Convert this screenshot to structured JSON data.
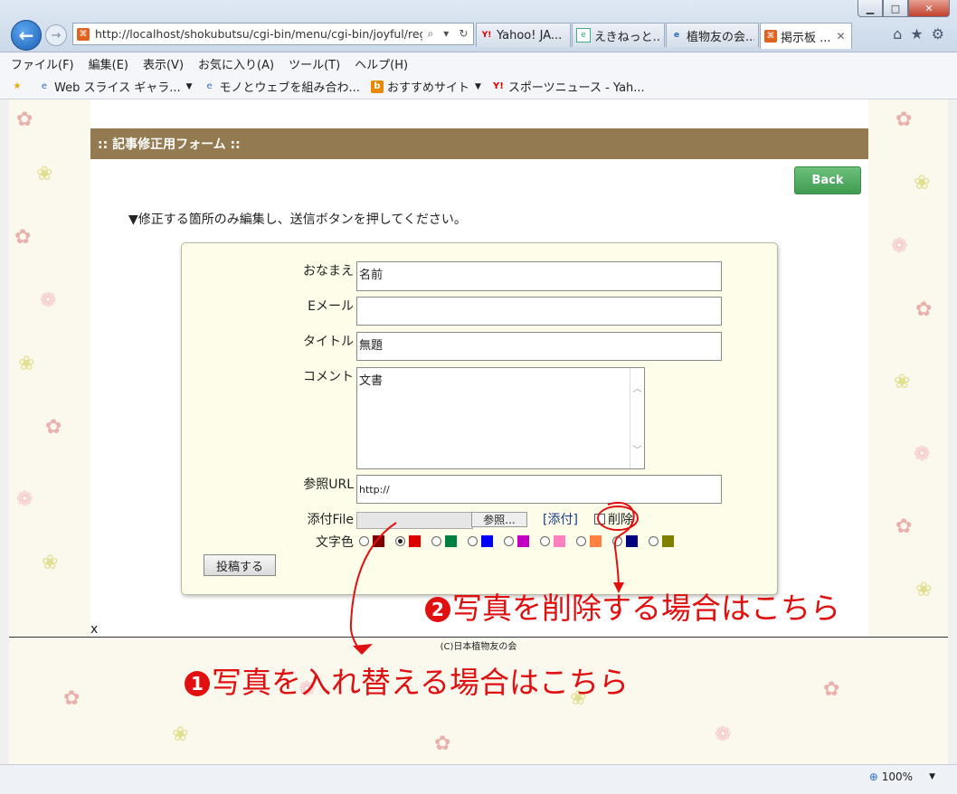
{
  "browser": {
    "address_url": "http://localhost/shokubutsu/cgi-bin/menu/cgi-bin/joyful/regist",
    "tabs": [
      {
        "label": "Yahoo! JA...",
        "icon": "Y!"
      },
      {
        "label": "えきねっと...",
        "icon": "e"
      },
      {
        "label": "植物友の会...",
        "icon": "e"
      },
      {
        "label": "掲示板 ...",
        "icon": "⌘"
      }
    ],
    "menu": [
      "ファイル(F)",
      "編集(E)",
      "表示(V)",
      "お気に入り(A)",
      "ツール(T)",
      "ヘルプ(H)"
    ],
    "favorites": [
      {
        "label": "Web スライス ギャラ...",
        "has_dropdown": true
      },
      {
        "label": "モノとウェブを組み合わ...",
        "has_dropdown": false
      },
      {
        "label": "おすすめサイト",
        "has_dropdown": true
      },
      {
        "label": "スポーツニュース - Yah...",
        "has_dropdown": false
      }
    ],
    "zoom": "100%"
  },
  "page": {
    "header": ":: 記事修正用フォーム ::",
    "back_label": "Back",
    "instruction": "▼修正する箇所のみ編集し、送信ボタンを押してください。",
    "form": {
      "name_label": "おなまえ",
      "name_value": "名前",
      "email_label": "Eメール",
      "email_value": "",
      "title_label": "タイトル",
      "title_value": "無題",
      "comment_label": "コメント",
      "comment_value": "文書",
      "url_label": "参照URL",
      "url_value": "http://",
      "file_label": "添付File",
      "browse_label": "参照...",
      "attach_link": "[添付]",
      "delete_label": "削除",
      "color_label": "文字色",
      "colors": [
        "#800000",
        "#df0000",
        "#008040",
        "#0000ff",
        "#c100c1",
        "#ff80c0",
        "#ff8040",
        "#000080",
        "#808000"
      ],
      "selected_color_index": 1,
      "submit_label": "投稿する"
    },
    "stray_char": "x",
    "copyright": "(C)日本植物友の会"
  },
  "annotations": {
    "replace": {
      "num": "1",
      "text": "写真を入れ替える場合はこちら"
    },
    "delete": {
      "num": "2",
      "text": "写真を削除する場合はこちら"
    }
  },
  "accent_color": "#e01010"
}
